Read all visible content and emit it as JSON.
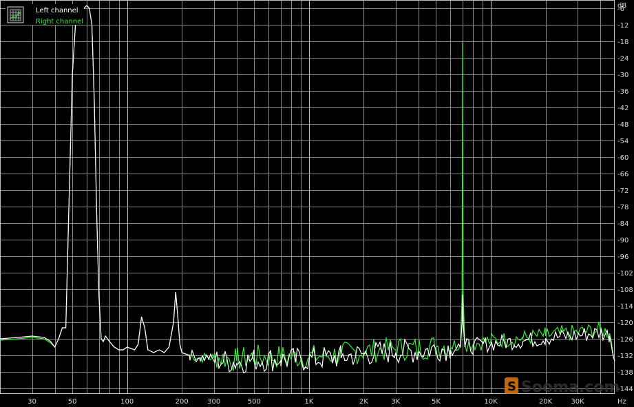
{
  "chart_data": {
    "type": "line",
    "x_scale": "log",
    "xlim": [
      20,
      48000
    ],
    "ylim": [
      -146,
      -3
    ],
    "grid": true,
    "legend_position": "top-left",
    "legend_icon": "grid-chart-icon",
    "xlabel": "Hz",
    "ylabel": "dB",
    "x_ticks": [
      {
        "value": 30,
        "label": "30"
      },
      {
        "value": 50,
        "label": "50"
      },
      {
        "value": 100,
        "label": "100"
      },
      {
        "value": 200,
        "label": "200"
      },
      {
        "value": 300,
        "label": "300"
      },
      {
        "value": 500,
        "label": "500"
      },
      {
        "value": 1000,
        "label": "1K"
      },
      {
        "value": 2000,
        "label": "2K"
      },
      {
        "value": 3000,
        "label": "3K"
      },
      {
        "value": 5000,
        "label": "5K"
      },
      {
        "value": 10000,
        "label": "10K"
      },
      {
        "value": 20000,
        "label": "20K"
      },
      {
        "value": 30000,
        "label": "30K"
      }
    ],
    "y_ticks": [
      -6,
      -12,
      -18,
      -24,
      -30,
      -36,
      -42,
      -48,
      -54,
      -60,
      -66,
      -72,
      -78,
      -84,
      -90,
      -96,
      -102,
      -108,
      -114,
      -120,
      -126,
      -132,
      -138,
      -144
    ],
    "series": [
      {
        "name": "Left channel",
        "color": "#ffffff",
        "x": [
          20,
          25,
          30,
          35,
          38,
          40,
          42,
          44,
          46,
          48,
          50,
          52,
          54,
          56,
          58,
          60,
          62,
          64,
          66,
          68,
          70,
          72,
          74,
          76,
          78,
          80,
          85,
          90,
          95,
          100,
          110,
          115,
          120,
          125,
          130,
          140,
          150,
          160,
          170,
          180,
          185,
          190,
          195,
          200,
          220,
          250,
          280,
          300,
          400,
          500,
          700,
          1000,
          1500,
          2000,
          3000,
          4000,
          5000,
          6000,
          6800,
          6950,
          7000,
          7050,
          7200,
          8000,
          10000,
          15000,
          20000,
          30000,
          40000,
          45000,
          48000
        ],
        "y": [
          -126,
          -125.5,
          -125,
          -125.5,
          -127,
          -129,
          -126,
          -122,
          -122,
          -75,
          -30,
          -12,
          -8,
          -7,
          -6,
          -5,
          -6,
          -12,
          -40,
          -80,
          -110,
          -126,
          -127,
          -125,
          -126,
          -127,
          -129,
          -130,
          -130,
          -129,
          -130,
          -128,
          -118,
          -122,
          -130,
          -131,
          -130,
          -131,
          -129,
          -120,
          -109,
          -118,
          -128,
          -131,
          -132,
          -133,
          -133,
          -134,
          -135,
          -134,
          -134,
          -134,
          -133,
          -132,
          -131,
          -131,
          -130,
          -130,
          -129,
          -120,
          -110,
          -120,
          -129,
          -129,
          -128,
          -127,
          -126,
          -125,
          -124,
          -125,
          -134
        ]
      },
      {
        "name": "Right channel",
        "color": "#33ee33",
        "x": [
          20,
          25,
          30,
          35,
          38,
          40,
          42,
          44,
          46,
          48,
          50,
          52,
          54,
          56,
          58,
          60,
          62,
          64,
          66,
          68,
          70,
          72,
          74,
          76,
          78,
          80,
          85,
          90,
          95,
          100,
          110,
          115,
          120,
          125,
          130,
          140,
          150,
          160,
          170,
          180,
          185,
          190,
          195,
          200,
          220,
          250,
          280,
          300,
          400,
          500,
          700,
          1000,
          1500,
          2000,
          3000,
          4000,
          5000,
          6000,
          6800,
          6950,
          7000,
          7050,
          7200,
          8000,
          10000,
          15000,
          20000,
          30000,
          40000,
          45000,
          48000
        ],
        "y": [
          -126.5,
          -126,
          -125.5,
          -126,
          -127.5,
          -129,
          -126,
          -122,
          -122,
          -75,
          -30,
          -12,
          -8,
          -7,
          -6,
          -5,
          -6,
          -12,
          -40,
          -80,
          -110,
          -126,
          -127,
          -125,
          -126,
          -127,
          -129,
          -130,
          -130,
          -129,
          -130,
          -128,
          -118,
          -122,
          -130,
          -131,
          -130,
          -131,
          -129,
          -120,
          -109,
          -118,
          -128,
          -131,
          -132,
          -133,
          -133,
          -133,
          -134,
          -133,
          -133,
          -133,
          -132,
          -131,
          -130,
          -130,
          -129,
          -129,
          -128,
          -110,
          -18,
          -110,
          -128,
          -128,
          -127,
          -126,
          -125,
          -124,
          -123,
          -124,
          -134
        ]
      }
    ]
  },
  "watermark": {
    "text": "Sooma.com",
    "color": "#e07a10"
  }
}
